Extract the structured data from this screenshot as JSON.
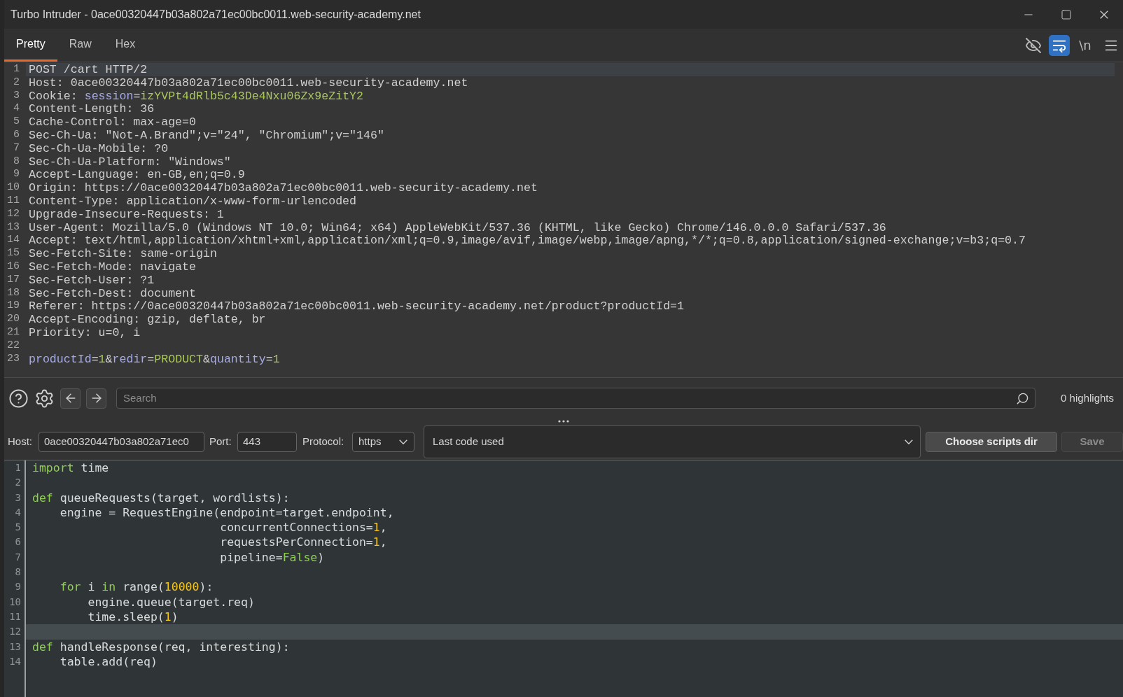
{
  "window": {
    "title": "Turbo Intruder - 0ace00320447b03a802a71ec00bc0011.web-security-academy.net"
  },
  "request_editor": {
    "tabs": [
      {
        "label": "Pretty",
        "selected": true
      },
      {
        "label": "Raw",
        "selected": false
      },
      {
        "label": "Hex",
        "selected": false
      }
    ],
    "toggles": [
      {
        "kind": "hide",
        "on": false
      },
      {
        "kind": "wrap",
        "on": true
      },
      {
        "kind": "newline",
        "label": "\\n",
        "on": false
      }
    ],
    "lines": [
      {
        "number": "1",
        "current": true,
        "segments": [
          {
            "kind": "plain",
            "text": "POST /cart HTTP/2"
          }
        ]
      },
      {
        "number": "2",
        "current": false,
        "segments": [
          {
            "kind": "plain",
            "text": "Host: 0ace00320447b03a802a71ec00bc0011.web-security-academy.net"
          }
        ]
      },
      {
        "number": "3",
        "current": false,
        "segments": [
          {
            "kind": "plain",
            "text": "Cookie: "
          },
          {
            "kind": "name",
            "text": "session"
          },
          {
            "kind": "plain",
            "text": "="
          },
          {
            "kind": "value",
            "text": "izYVPt4dRlb5c43De4Nxu06Zx9eZitY2"
          }
        ]
      },
      {
        "number": "4",
        "current": false,
        "segments": [
          {
            "kind": "plain",
            "text": "Content-Length: 36"
          }
        ]
      },
      {
        "number": "5",
        "current": false,
        "segments": [
          {
            "kind": "plain",
            "text": "Cache-Control: max-age=0"
          }
        ]
      },
      {
        "number": "6",
        "current": false,
        "segments": [
          {
            "kind": "plain",
            "text": "Sec-Ch-Ua: \"Not-A.Brand\";v=\"24\", \"Chromium\";v=\"146\""
          }
        ]
      },
      {
        "number": "7",
        "current": false,
        "segments": [
          {
            "kind": "plain",
            "text": "Sec-Ch-Ua-Mobile: ?0"
          }
        ]
      },
      {
        "number": "8",
        "current": false,
        "segments": [
          {
            "kind": "plain",
            "text": "Sec-Ch-Ua-Platform: \"Windows\""
          }
        ]
      },
      {
        "number": "9",
        "current": false,
        "segments": [
          {
            "kind": "plain",
            "text": "Accept-Language: en-GB,en;q=0.9"
          }
        ]
      },
      {
        "number": "10",
        "current": false,
        "segments": [
          {
            "kind": "plain",
            "text": "Origin: https://0ace00320447b03a802a71ec00bc0011.web-security-academy.net"
          }
        ]
      },
      {
        "number": "11",
        "current": false,
        "segments": [
          {
            "kind": "plain",
            "text": "Content-Type: application/x-www-form-urlencoded"
          }
        ]
      },
      {
        "number": "12",
        "current": false,
        "segments": [
          {
            "kind": "plain",
            "text": "Upgrade-Insecure-Requests: 1"
          }
        ]
      },
      {
        "number": "13",
        "current": false,
        "segments": [
          {
            "kind": "plain",
            "text": "User-Agent: Mozilla/5.0 (Windows NT 10.0; Win64; x64) AppleWebKit/537.36 (KHTML, like Gecko) Chrome/146.0.0.0 Safari/537.36"
          }
        ]
      },
      {
        "number": "14",
        "current": false,
        "segments": [
          {
            "kind": "plain",
            "text": "Accept: text/html,application/xhtml+xml,application/xml;q=0.9,image/avif,image/webp,image/apng,*/*;q=0.8,application/signed-exchange;v=b3;q=0.7"
          }
        ]
      },
      {
        "number": "15",
        "current": false,
        "segments": [
          {
            "kind": "plain",
            "text": "Sec-Fetch-Site: same-origin"
          }
        ]
      },
      {
        "number": "16",
        "current": false,
        "segments": [
          {
            "kind": "plain",
            "text": "Sec-Fetch-Mode: navigate"
          }
        ]
      },
      {
        "number": "17",
        "current": false,
        "segments": [
          {
            "kind": "plain",
            "text": "Sec-Fetch-User: ?1"
          }
        ]
      },
      {
        "number": "18",
        "current": false,
        "segments": [
          {
            "kind": "plain",
            "text": "Sec-Fetch-Dest: document"
          }
        ]
      },
      {
        "number": "19",
        "current": false,
        "segments": [
          {
            "kind": "plain",
            "text": "Referer: https://0ace00320447b03a802a71ec00bc0011.web-security-academy.net/product?productId=1"
          }
        ]
      },
      {
        "number": "20",
        "current": false,
        "segments": [
          {
            "kind": "plain",
            "text": "Accept-Encoding: gzip, deflate, br"
          }
        ]
      },
      {
        "number": "21",
        "current": false,
        "segments": [
          {
            "kind": "plain",
            "text": "Priority: u=0, i"
          }
        ]
      },
      {
        "number": "22",
        "current": false
      },
      {
        "number": "23",
        "current": false,
        "segments": [
          {
            "kind": "name",
            "text": "productId"
          },
          {
            "kind": "plain",
            "text": "="
          },
          {
            "kind": "value",
            "text": "1"
          },
          {
            "kind": "plain",
            "text": "&"
          },
          {
            "kind": "name",
            "text": "redir"
          },
          {
            "kind": "plain",
            "text": "="
          },
          {
            "kind": "value",
            "text": "PRODUCT"
          },
          {
            "kind": "plain",
            "text": "&"
          },
          {
            "kind": "name",
            "text": "quantity"
          },
          {
            "kind": "plain",
            "text": "="
          },
          {
            "kind": "value",
            "text": "1"
          }
        ]
      }
    ]
  },
  "search": {
    "placeholder": "Search",
    "highlights": "0 highlights"
  },
  "connection": {
    "host_label": "Host:",
    "host": "0ace00320447b03a802a71ec0",
    "port_label": "Port:",
    "port": "443",
    "protocol_label": "Protocol:",
    "protocol": "https",
    "script": "Last code used",
    "buttons": [
      {
        "label": "Choose scripts dir",
        "disabled": false
      },
      {
        "label": "Save",
        "disabled": true
      }
    ]
  },
  "script_editor": {
    "lines": [
      {
        "number": "1",
        "current": false,
        "tokens": [
          {
            "kind": "keyword",
            "text": "import"
          },
          {
            "kind": "plain",
            "text": " time"
          }
        ]
      },
      {
        "number": "2",
        "current": false
      },
      {
        "number": "3",
        "current": false,
        "tokens": [
          {
            "kind": "keyword",
            "text": "def"
          },
          {
            "kind": "plain",
            "text": " queueRequests(target, wordlists):"
          }
        ]
      },
      {
        "number": "4",
        "current": false,
        "tokens": [
          {
            "kind": "plain",
            "text": "    engine = RequestEngine(endpoint=target.endpoint,"
          }
        ]
      },
      {
        "number": "5",
        "current": false,
        "tokens": [
          {
            "kind": "plain",
            "text": "                           concurrentConnections="
          },
          {
            "kind": "number",
            "text": "1"
          },
          {
            "kind": "plain",
            "text": ","
          }
        ]
      },
      {
        "number": "6",
        "current": false,
        "tokens": [
          {
            "kind": "plain",
            "text": "                           requestsPerConnection="
          },
          {
            "kind": "number",
            "text": "1"
          },
          {
            "kind": "plain",
            "text": ","
          }
        ]
      },
      {
        "number": "7",
        "current": false,
        "tokens": [
          {
            "kind": "plain",
            "text": "                           pipeline="
          },
          {
            "kind": "keyword",
            "text": "False"
          },
          {
            "kind": "plain",
            "text": ")"
          }
        ]
      },
      {
        "number": "8",
        "current": false
      },
      {
        "number": "9",
        "current": false,
        "tokens": [
          {
            "kind": "keyword",
            "text": "    for"
          },
          {
            "kind": "plain",
            "text": " i "
          },
          {
            "kind": "keyword",
            "text": "in"
          },
          {
            "kind": "plain",
            "text": " range("
          },
          {
            "kind": "number",
            "text": "10000"
          },
          {
            "kind": "plain",
            "text": "):"
          }
        ]
      },
      {
        "number": "10",
        "current": false,
        "tokens": [
          {
            "kind": "plain",
            "text": "        engine.queue(target.req)"
          }
        ]
      },
      {
        "number": "11",
        "current": false,
        "tokens": [
          {
            "kind": "plain",
            "text": "        time.sleep("
          },
          {
            "kind": "number",
            "text": "1"
          },
          {
            "kind": "plain",
            "text": ")"
          }
        ]
      },
      {
        "number": "12",
        "current": true
      },
      {
        "number": "13",
        "current": false,
        "tokens": [
          {
            "kind": "keyword",
            "text": "def"
          },
          {
            "kind": "plain",
            "text": " handleResponse(req, interesting):"
          }
        ]
      },
      {
        "number": "14",
        "current": false,
        "tokens": [
          {
            "kind": "plain",
            "text": "    table.add(req)"
          }
        ]
      }
    ]
  }
}
